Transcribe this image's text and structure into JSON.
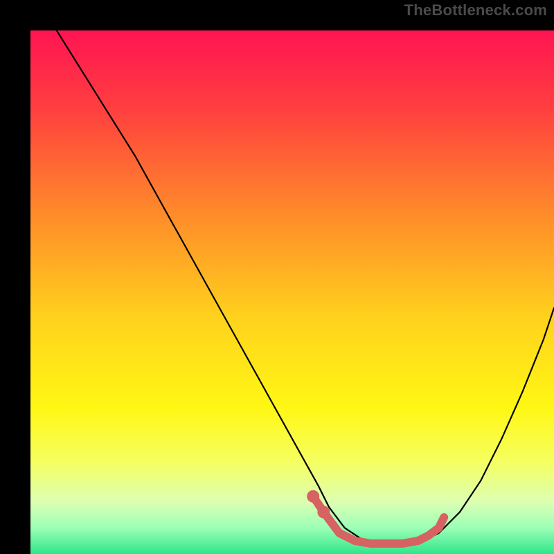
{
  "watermark": "TheBottleneck.com",
  "colors": {
    "bg": "#000000",
    "curve": "#000000",
    "marker": "#d66262",
    "gradient_stops": [
      {
        "offset": 0.0,
        "color": "#ff1452"
      },
      {
        "offset": 0.15,
        "color": "#ff3f3f"
      },
      {
        "offset": 0.35,
        "color": "#ff8b2a"
      },
      {
        "offset": 0.55,
        "color": "#ffd21c"
      },
      {
        "offset": 0.72,
        "color": "#fff714"
      },
      {
        "offset": 0.82,
        "color": "#f6ff5d"
      },
      {
        "offset": 0.9,
        "color": "#ddffb2"
      },
      {
        "offset": 0.95,
        "color": "#9cffb7"
      },
      {
        "offset": 1.0,
        "color": "#2fe58a"
      }
    ]
  },
  "chart_data": {
    "type": "line",
    "title": "",
    "xlabel": "",
    "ylabel": "",
    "xlim": [
      0,
      100
    ],
    "ylim": [
      0,
      100
    ],
    "series": [
      {
        "name": "bottleneck-curve",
        "x": [
          5,
          10,
          15,
          20,
          25,
          30,
          35,
          40,
          45,
          50,
          55,
          57,
          60,
          63,
          66,
          70,
          74,
          78,
          82,
          86,
          90,
          94,
          98,
          100
        ],
        "y": [
          100,
          92,
          84,
          76,
          67,
          58,
          49,
          40,
          31,
          22,
          13,
          9,
          5,
          3,
          2,
          2,
          2,
          4,
          8,
          14,
          22,
          31,
          41,
          47
        ]
      }
    ],
    "markers": {
      "name": "highlighted-segment",
      "x": [
        54,
        56,
        59,
        62,
        65,
        68,
        71,
        74,
        76,
        78,
        79
      ],
      "y": [
        11,
        8,
        4,
        2.5,
        2,
        2,
        2,
        2.5,
        3.5,
        5,
        7
      ]
    }
  }
}
